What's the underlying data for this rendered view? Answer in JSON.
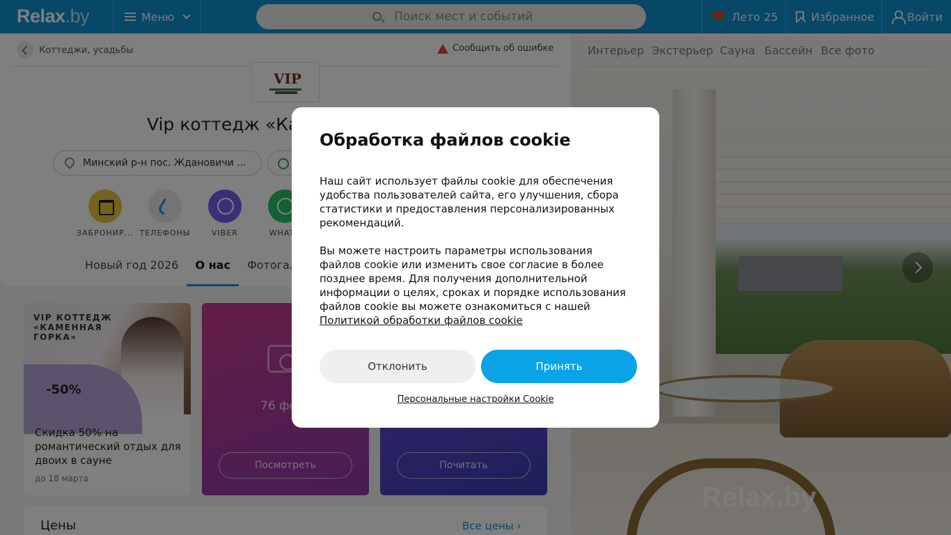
{
  "header": {
    "logo_main": "Relax",
    "logo_suffix": ".by",
    "menu_label": "Меню",
    "search_placeholder": "Поиск мест и событий",
    "summer_label": "Лето 25",
    "favorites_label": "Избранное",
    "login_label": "Войти"
  },
  "page": {
    "breadcrumb": "Коттеджи, усадьбы",
    "report_error": "Сообщить об ошибке",
    "title": "Vip коттедж «Ка",
    "address": "Минский р-н пос. Ждановичи ...",
    "actions": [
      {
        "label": "ЗАБРОНИР..."
      },
      {
        "label": "ТЕЛЕФОНЫ"
      },
      {
        "label": "VIBER"
      },
      {
        "label": "WHATS"
      }
    ],
    "tabs": [
      {
        "label": "Новый год 2026"
      },
      {
        "label": "О нас"
      },
      {
        "label": "Фотогале"
      }
    ]
  },
  "promo": {
    "caption": "VIP КОТТЕДЖ «КАМЕННАЯ ГОРКА»",
    "discount": "-50%",
    "text": "Скидка 50% на романтический отдых для двоих в сауне",
    "date": "до 18 марта"
  },
  "photos_card": {
    "count": "76 фо",
    "button": "Посмотреть"
  },
  "read_card": {
    "button": "Почитать"
  },
  "prices": {
    "title": "Цены",
    "all_link": "Все цены"
  },
  "gallery": {
    "tabs": [
      "Интерьер",
      "Экстерьер",
      "Сауна",
      "Бассейн",
      "Все фото"
    ],
    "watermark": "Relax.by"
  },
  "cookie_modal": {
    "title": "Обработка файлов cookie",
    "paragraph1": "Наш сайт использует файлы cookie для обеспечения удобства пользователей сайта, его улучшения, сбора статистики и предоставления персонализированных рекомендаций.",
    "paragraph2": "Вы можете настроить параметры использования файлов cookie или изменить свое согласие в более позднее время. Для получения дополнительной информации о целях, сроках и порядке использования файлов cookie вы можете ознакомиться с нашей",
    "policy_link": "Политикой обработки файлов cookie",
    "decline": "Отклонить",
    "accept": "Принять",
    "settings": "Персональные настройки Cookie"
  },
  "colors": {
    "header_bg": "#0e8fd1",
    "accent": "#0aa3e8",
    "active_tab": "#1a8fd3"
  }
}
